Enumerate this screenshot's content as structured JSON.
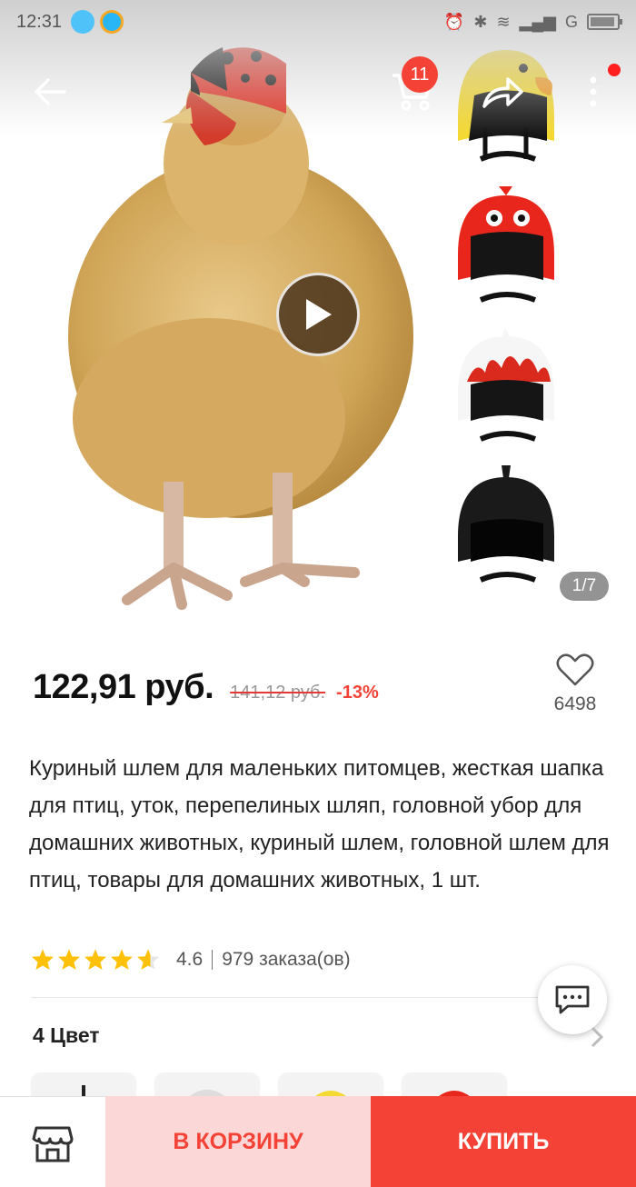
{
  "status_bar": {
    "time": "12:31",
    "network": "G"
  },
  "gallery": {
    "cart_badge": "11",
    "page_indicator": "1/7",
    "thumbnails": [
      "yellow-duck-helmet",
      "red-ladybug-helmet",
      "white-flame-helmet",
      "black-helmet"
    ]
  },
  "product": {
    "price": "122,91 руб.",
    "old_price": "141,12 руб.",
    "discount": "-13%",
    "wishlist_count": "6498",
    "title": "Куриный шлем для маленьких питомцев, жесткая шапка для птиц, уток, перепелиных шляп, головной убор для домашних животных, куриный шлем, головной шлем для птиц, товары для домашних животных, 1 шт.",
    "rating": "4.6",
    "orders": "979 заказа(ов)",
    "color_label": "4 Цвет"
  },
  "actions": {
    "add_to_cart": "В КОРЗИНУ",
    "buy": "КУПИТЬ"
  },
  "colors": {
    "accent": "#f44336",
    "cart_button_bg": "#fcd7d7",
    "star": "#ffc107"
  }
}
